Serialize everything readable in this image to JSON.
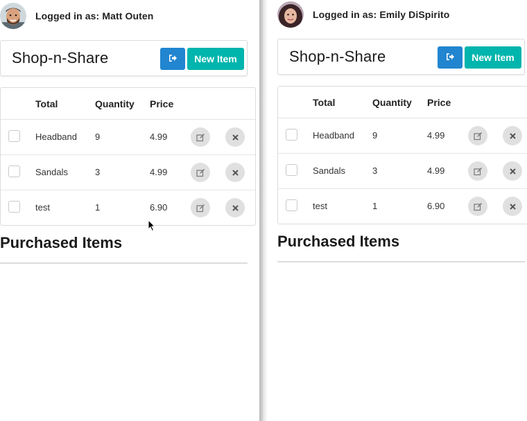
{
  "left": {
    "user": {
      "label": "Logged in as:",
      "name": "Matt Outen"
    },
    "app_title": "Shop-n-Share",
    "new_item_label": "New Item",
    "columns": [
      "Total",
      "Quantity",
      "Price"
    ],
    "rows": [
      {
        "name": "Headband",
        "qty": "9",
        "price": "4.99"
      },
      {
        "name": "Sandals",
        "qty": "3",
        "price": "4.99"
      },
      {
        "name": "test",
        "qty": "1",
        "price": "6.90"
      }
    ],
    "purchased_title": "Purchased Items"
  },
  "right": {
    "user": {
      "label": "Logged in as:",
      "name": "Emily DiSpirito"
    },
    "app_title": "Shop-n-Share",
    "new_item_label": "New Item",
    "columns": [
      "Total",
      "Quantity",
      "Price"
    ],
    "rows": [
      {
        "name": "Headband",
        "qty": "9",
        "price": "4.99"
      },
      {
        "name": "Sandals",
        "qty": "3",
        "price": "4.99"
      },
      {
        "name": "test",
        "qty": "1",
        "price": "6.90"
      }
    ],
    "purchased_title": "Purchased Items"
  },
  "icons": {
    "logout": "sign-out-icon",
    "edit": "edit-icon",
    "delete": "close-icon"
  },
  "colors": {
    "logout_button": "#2185d0",
    "new_item_button": "#00b5ad",
    "action_circle": "#e0e0e0"
  }
}
